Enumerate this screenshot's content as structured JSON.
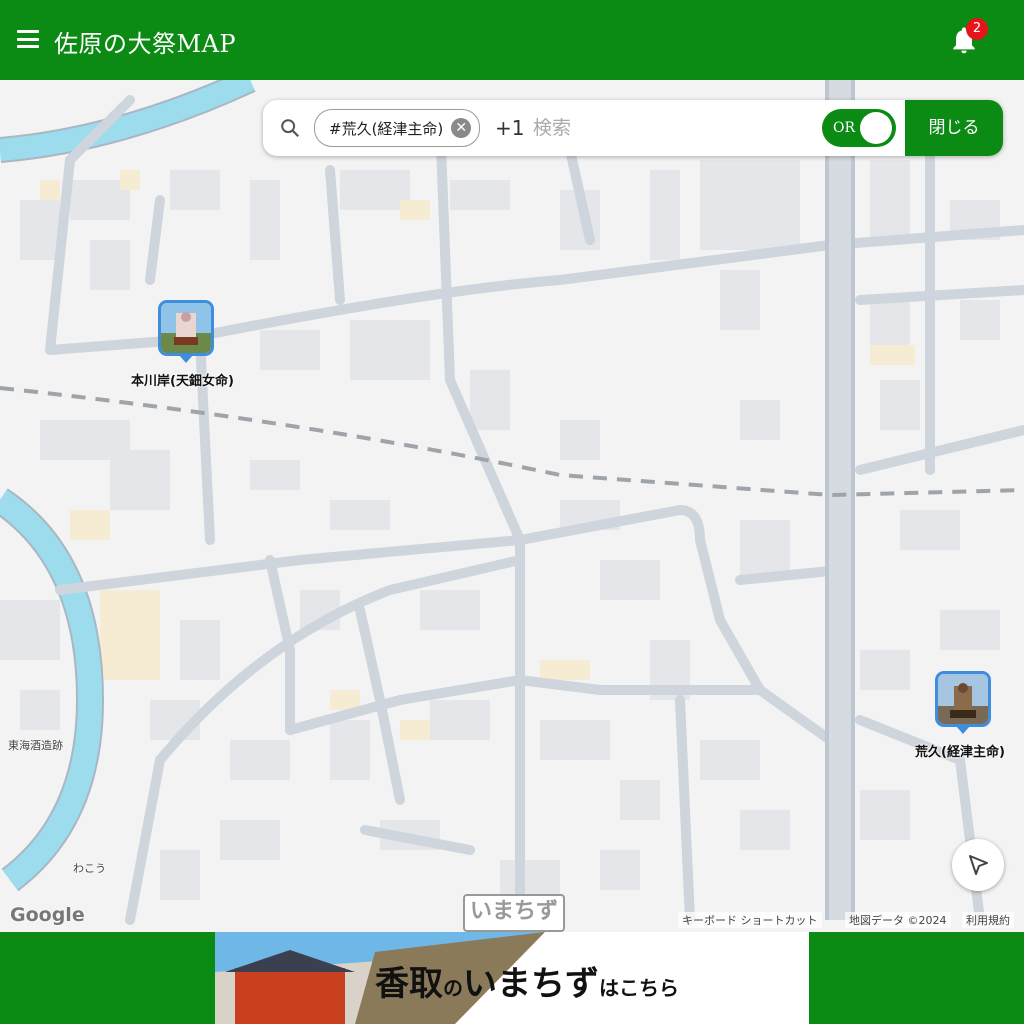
{
  "header": {
    "title": "佐原の大祭MAP",
    "notification_count": "2"
  },
  "search": {
    "chip_label": "#荒久(経津主命)",
    "more_count": "+1",
    "placeholder": "検索",
    "toggle_label": "OR",
    "close_label": "閉じる"
  },
  "map": {
    "markers": [
      {
        "label": "本川岸(天鈿女命)",
        "icon": "float-photo-icon"
      },
      {
        "label": "荒久(経津主命)",
        "icon": "float-photo-icon"
      }
    ],
    "poi": [
      {
        "label": "東海酒造跡"
      },
      {
        "label": "わこう"
      }
    ],
    "attribution": {
      "google": "Google",
      "shortcuts": "キーボード ショートカット",
      "map_data": "地図データ ©2024",
      "terms": "利用規約"
    },
    "watermark": "いまちず"
  },
  "footer": {
    "banner_text_1": "香取",
    "banner_text_2": "の",
    "banner_text_3": "いまちず",
    "banner_text_4": "はこちら"
  },
  "colors": {
    "brand_green": "#0b8a14",
    "badge_red": "#e8141b",
    "marker_blue": "#3f8ede",
    "river": "#9cdcec"
  }
}
